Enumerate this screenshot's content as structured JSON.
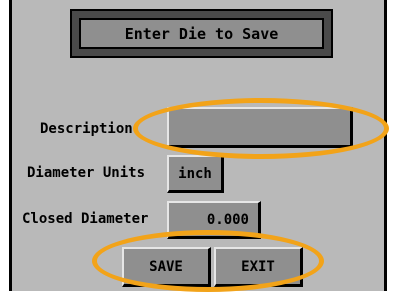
{
  "screen": {
    "title": "Enter Die to Save"
  },
  "form": {
    "description_label": "Description",
    "description_value": "",
    "diameter_units_label": "Diameter Units",
    "diameter_units_value": "inch",
    "closed_diameter_label": "Closed Diameter",
    "closed_diameter_value": "0.000"
  },
  "buttons": {
    "save": "SAVE",
    "exit": "EXIT"
  },
  "annotation_color": "#f2a319"
}
